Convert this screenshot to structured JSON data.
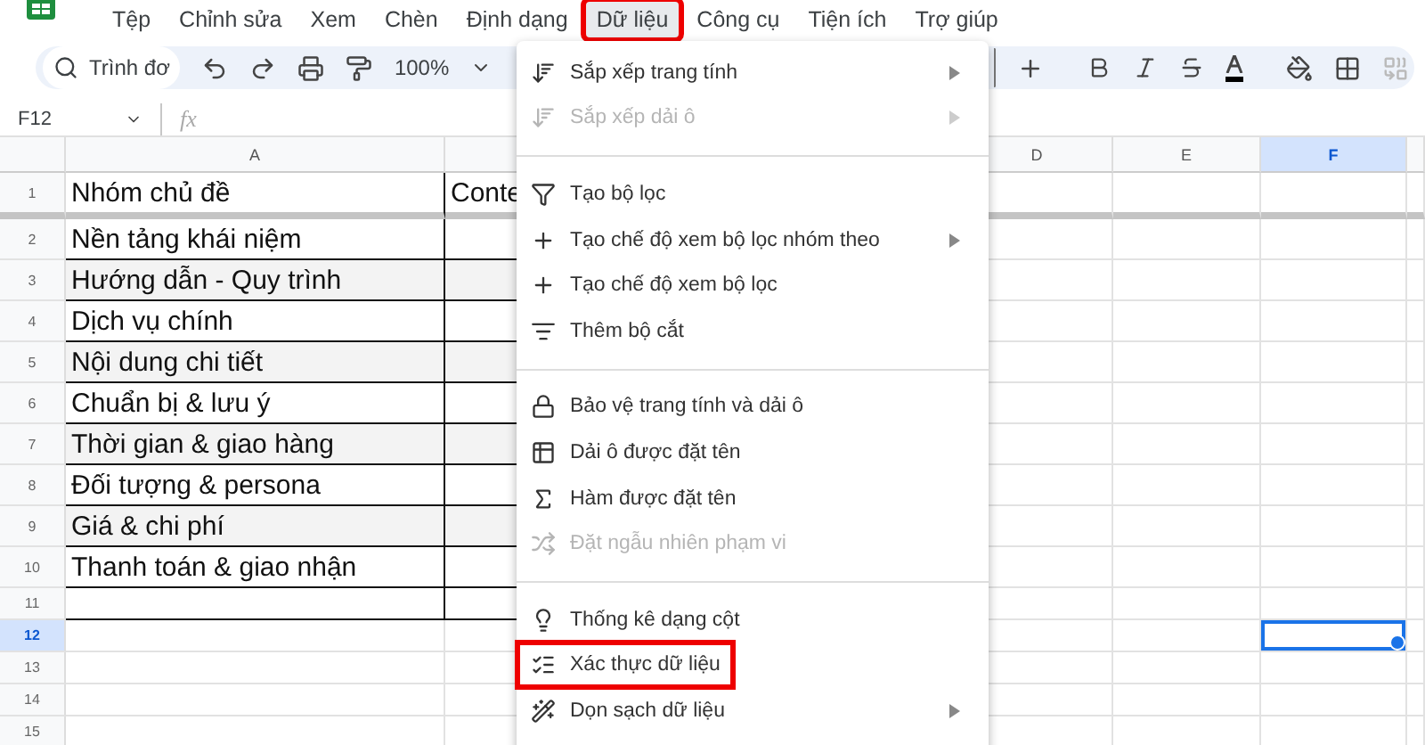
{
  "menubar": [
    {
      "label": "Tệp",
      "selected": false,
      "highlighted": false
    },
    {
      "label": "Chỉnh sửa",
      "selected": false,
      "highlighted": false
    },
    {
      "label": "Xem",
      "selected": false,
      "highlighted": false
    },
    {
      "label": "Chèn",
      "selected": false,
      "highlighted": false
    },
    {
      "label": "Định dạng",
      "selected": false,
      "highlighted": false
    },
    {
      "label": "Dữ liệu",
      "selected": true,
      "highlighted": true
    },
    {
      "label": "Công cụ",
      "selected": false,
      "highlighted": false
    },
    {
      "label": "Tiện ích",
      "selected": false,
      "highlighted": false
    },
    {
      "label": "Trợ giúp",
      "selected": false,
      "highlighted": false
    }
  ],
  "toolbar": {
    "search_label": "Trình đơ",
    "zoom": "100%"
  },
  "formula_bar": {
    "cell_ref": "F12",
    "fx": "fx"
  },
  "columns": [
    {
      "label": "A",
      "selected": false
    },
    {
      "label": "D",
      "selected": false
    },
    {
      "label": "E",
      "selected": false
    },
    {
      "label": "F",
      "selected": true
    }
  ],
  "rows": [
    {
      "number": "1",
      "cells": [
        "Nhóm chủ đề",
        "Conte"
      ],
      "bordered": true,
      "shaded": false,
      "selected": false
    },
    {
      "number": "2",
      "cells": [
        "Nền tảng khái niệm"
      ],
      "bordered": true,
      "shaded": false,
      "selected": false
    },
    {
      "number": "3",
      "cells": [
        "Hướng dẫn - Quy trình"
      ],
      "bordered": true,
      "shaded": true,
      "selected": false
    },
    {
      "number": "4",
      "cells": [
        "Dịch vụ chính"
      ],
      "bordered": true,
      "shaded": false,
      "selected": false
    },
    {
      "number": "5",
      "cells": [
        "Nội dung chi tiết"
      ],
      "bordered": true,
      "shaded": true,
      "selected": false
    },
    {
      "number": "6",
      "cells": [
        "Chuẩn bị & lưu ý"
      ],
      "bordered": true,
      "shaded": false,
      "selected": false
    },
    {
      "number": "7",
      "cells": [
        "Thời gian & giao hàng"
      ],
      "bordered": true,
      "shaded": true,
      "selected": false
    },
    {
      "number": "8",
      "cells": [
        "Đối tượng & persona"
      ],
      "bordered": true,
      "shaded": false,
      "selected": false
    },
    {
      "number": "9",
      "cells": [
        "Giá & chi phí"
      ],
      "bordered": true,
      "shaded": true,
      "selected": false
    },
    {
      "number": "10",
      "cells": [
        "Thanh toán & giao nhận"
      ],
      "bordered": true,
      "shaded": false,
      "selected": false
    },
    {
      "number": "11",
      "cells": [],
      "bordered": true,
      "shaded": false,
      "selected": false
    },
    {
      "number": "12",
      "cells": [],
      "bordered": false,
      "shaded": false,
      "selected": true
    },
    {
      "number": "13",
      "cells": [],
      "bordered": false,
      "shaded": false,
      "selected": false
    },
    {
      "number": "14",
      "cells": [],
      "bordered": false,
      "shaded": false,
      "selected": false
    },
    {
      "number": "15",
      "cells": [],
      "bordered": false,
      "shaded": false,
      "selected": false
    }
  ],
  "data_menu": [
    {
      "kind": "item",
      "label": "Sắp xếp trang tính",
      "disabled": false,
      "submenu": true,
      "highlighted": false
    },
    {
      "kind": "item",
      "label": "Sắp xếp dải ô",
      "disabled": true,
      "submenu": true,
      "highlighted": false
    },
    {
      "kind": "divider"
    },
    {
      "kind": "item",
      "label": "Tạo bộ lọc",
      "disabled": false,
      "submenu": false,
      "highlighted": false
    },
    {
      "kind": "item",
      "label": "Tạo chế độ xem bộ lọc nhóm theo",
      "disabled": false,
      "submenu": true,
      "highlighted": false
    },
    {
      "kind": "item",
      "label": "Tạo chế độ xem bộ lọc",
      "disabled": false,
      "submenu": false,
      "highlighted": false
    },
    {
      "kind": "item",
      "label": "Thêm bộ cắt",
      "disabled": false,
      "submenu": false,
      "highlighted": false
    },
    {
      "kind": "divider"
    },
    {
      "kind": "item",
      "label": "Bảo vệ trang tính và dải ô",
      "disabled": false,
      "submenu": false,
      "highlighted": false
    },
    {
      "kind": "item",
      "label": "Dải ô được đặt tên",
      "disabled": false,
      "submenu": false,
      "highlighted": false
    },
    {
      "kind": "item",
      "label": "Hàm được đặt tên",
      "disabled": false,
      "submenu": false,
      "highlighted": false
    },
    {
      "kind": "item",
      "label": "Đặt ngẫu nhiên phạm vi",
      "disabled": true,
      "submenu": false,
      "highlighted": false
    },
    {
      "kind": "divider"
    },
    {
      "kind": "item",
      "label": "Thống kê dạng cột",
      "disabled": false,
      "submenu": false,
      "highlighted": false
    },
    {
      "kind": "item",
      "label": "Xác thực dữ liệu",
      "disabled": false,
      "submenu": false,
      "highlighted": true
    },
    {
      "kind": "item",
      "label": "Dọn sạch dữ liệu",
      "disabled": false,
      "submenu": true,
      "highlighted": false
    }
  ]
}
